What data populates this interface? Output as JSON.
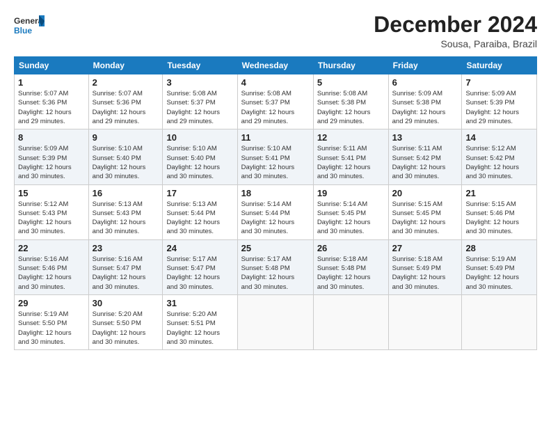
{
  "logo": {
    "line1": "General",
    "line2": "Blue"
  },
  "title": "December 2024",
  "subtitle": "Sousa, Paraiba, Brazil",
  "days_of_week": [
    "Sunday",
    "Monday",
    "Tuesday",
    "Wednesday",
    "Thursday",
    "Friday",
    "Saturday"
  ],
  "weeks": [
    [
      {
        "day": 1,
        "info": "Sunrise: 5:07 AM\nSunset: 5:36 PM\nDaylight: 12 hours\nand 29 minutes."
      },
      {
        "day": 2,
        "info": "Sunrise: 5:07 AM\nSunset: 5:36 PM\nDaylight: 12 hours\nand 29 minutes."
      },
      {
        "day": 3,
        "info": "Sunrise: 5:08 AM\nSunset: 5:37 PM\nDaylight: 12 hours\nand 29 minutes."
      },
      {
        "day": 4,
        "info": "Sunrise: 5:08 AM\nSunset: 5:37 PM\nDaylight: 12 hours\nand 29 minutes."
      },
      {
        "day": 5,
        "info": "Sunrise: 5:08 AM\nSunset: 5:38 PM\nDaylight: 12 hours\nand 29 minutes."
      },
      {
        "day": 6,
        "info": "Sunrise: 5:09 AM\nSunset: 5:38 PM\nDaylight: 12 hours\nand 29 minutes."
      },
      {
        "day": 7,
        "info": "Sunrise: 5:09 AM\nSunset: 5:39 PM\nDaylight: 12 hours\nand 29 minutes."
      }
    ],
    [
      {
        "day": 8,
        "info": "Sunrise: 5:09 AM\nSunset: 5:39 PM\nDaylight: 12 hours\nand 30 minutes."
      },
      {
        "day": 9,
        "info": "Sunrise: 5:10 AM\nSunset: 5:40 PM\nDaylight: 12 hours\nand 30 minutes."
      },
      {
        "day": 10,
        "info": "Sunrise: 5:10 AM\nSunset: 5:40 PM\nDaylight: 12 hours\nand 30 minutes."
      },
      {
        "day": 11,
        "info": "Sunrise: 5:10 AM\nSunset: 5:41 PM\nDaylight: 12 hours\nand 30 minutes."
      },
      {
        "day": 12,
        "info": "Sunrise: 5:11 AM\nSunset: 5:41 PM\nDaylight: 12 hours\nand 30 minutes."
      },
      {
        "day": 13,
        "info": "Sunrise: 5:11 AM\nSunset: 5:42 PM\nDaylight: 12 hours\nand 30 minutes."
      },
      {
        "day": 14,
        "info": "Sunrise: 5:12 AM\nSunset: 5:42 PM\nDaylight: 12 hours\nand 30 minutes."
      }
    ],
    [
      {
        "day": 15,
        "info": "Sunrise: 5:12 AM\nSunset: 5:43 PM\nDaylight: 12 hours\nand 30 minutes."
      },
      {
        "day": 16,
        "info": "Sunrise: 5:13 AM\nSunset: 5:43 PM\nDaylight: 12 hours\nand 30 minutes."
      },
      {
        "day": 17,
        "info": "Sunrise: 5:13 AM\nSunset: 5:44 PM\nDaylight: 12 hours\nand 30 minutes."
      },
      {
        "day": 18,
        "info": "Sunrise: 5:14 AM\nSunset: 5:44 PM\nDaylight: 12 hours\nand 30 minutes."
      },
      {
        "day": 19,
        "info": "Sunrise: 5:14 AM\nSunset: 5:45 PM\nDaylight: 12 hours\nand 30 minutes."
      },
      {
        "day": 20,
        "info": "Sunrise: 5:15 AM\nSunset: 5:45 PM\nDaylight: 12 hours\nand 30 minutes."
      },
      {
        "day": 21,
        "info": "Sunrise: 5:15 AM\nSunset: 5:46 PM\nDaylight: 12 hours\nand 30 minutes."
      }
    ],
    [
      {
        "day": 22,
        "info": "Sunrise: 5:16 AM\nSunset: 5:46 PM\nDaylight: 12 hours\nand 30 minutes."
      },
      {
        "day": 23,
        "info": "Sunrise: 5:16 AM\nSunset: 5:47 PM\nDaylight: 12 hours\nand 30 minutes."
      },
      {
        "day": 24,
        "info": "Sunrise: 5:17 AM\nSunset: 5:47 PM\nDaylight: 12 hours\nand 30 minutes."
      },
      {
        "day": 25,
        "info": "Sunrise: 5:17 AM\nSunset: 5:48 PM\nDaylight: 12 hours\nand 30 minutes."
      },
      {
        "day": 26,
        "info": "Sunrise: 5:18 AM\nSunset: 5:48 PM\nDaylight: 12 hours\nand 30 minutes."
      },
      {
        "day": 27,
        "info": "Sunrise: 5:18 AM\nSunset: 5:49 PM\nDaylight: 12 hours\nand 30 minutes."
      },
      {
        "day": 28,
        "info": "Sunrise: 5:19 AM\nSunset: 5:49 PM\nDaylight: 12 hours\nand 30 minutes."
      }
    ],
    [
      {
        "day": 29,
        "info": "Sunrise: 5:19 AM\nSunset: 5:50 PM\nDaylight: 12 hours\nand 30 minutes."
      },
      {
        "day": 30,
        "info": "Sunrise: 5:20 AM\nSunset: 5:50 PM\nDaylight: 12 hours\nand 30 minutes."
      },
      {
        "day": 31,
        "info": "Sunrise: 5:20 AM\nSunset: 5:51 PM\nDaylight: 12 hours\nand 30 minutes."
      },
      null,
      null,
      null,
      null
    ]
  ]
}
